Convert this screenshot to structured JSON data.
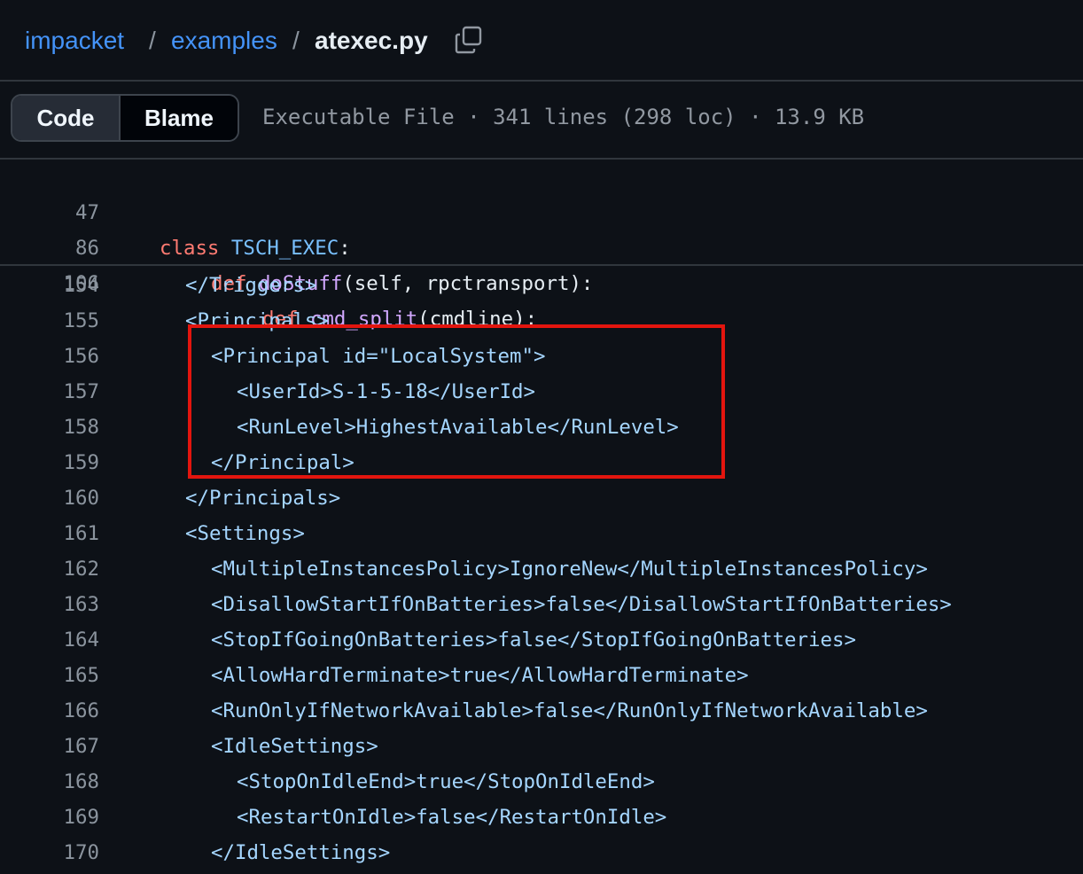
{
  "breadcrumb": {
    "repo": "impacket",
    "sep1": "/",
    "folder": "examples",
    "sep2": "/",
    "file": "atexec.py"
  },
  "toolbar": {
    "code_label": "Code",
    "blame_label": "Blame",
    "file_info": "Executable File · 341 lines (298 loc) · 13.9 KB"
  },
  "sticky_lines": [
    {
      "num": "47",
      "kw": "class",
      "name": "TSCH_EXEC",
      "rest": ":"
    },
    {
      "num": "86",
      "kw": "def",
      "name": "doStuff",
      "rest": "(self, rpctransport):"
    },
    {
      "num": "106",
      "kw": "def",
      "name": "cmd_split",
      "rest": "(cmdline):"
    }
  ],
  "code_lines": [
    {
      "num": "154",
      "text": "</Triggers>"
    },
    {
      "num": "155",
      "text": "<Principals>"
    },
    {
      "num": "156",
      "text": "<Principal id=\"LocalSystem\">"
    },
    {
      "num": "157",
      "text": "<UserId>S-1-5-18</UserId>"
    },
    {
      "num": "158",
      "text": "<RunLevel>HighestAvailable</RunLevel>"
    },
    {
      "num": "159",
      "text": "</Principal>"
    },
    {
      "num": "160",
      "text": "</Principals>"
    },
    {
      "num": "161",
      "text": "<Settings>"
    },
    {
      "num": "162",
      "text": "<MultipleInstancesPolicy>IgnoreNew</MultipleInstancesPolicy>"
    },
    {
      "num": "163",
      "text": "<DisallowStartIfOnBatteries>false</DisallowStartIfOnBatteries>"
    },
    {
      "num": "164",
      "text": "<StopIfGoingOnBatteries>false</StopIfGoingOnBatteries>"
    },
    {
      "num": "165",
      "text": "<AllowHardTerminate>true</AllowHardTerminate>"
    },
    {
      "num": "166",
      "text": "<RunOnlyIfNetworkAvailable>false</RunOnlyIfNetworkAvailable>"
    },
    {
      "num": "167",
      "text": "<IdleSettings>"
    },
    {
      "num": "168",
      "text": "<StopOnIdleEnd>true</StopOnIdleEnd>"
    },
    {
      "num": "169",
      "text": "<RestartOnIdle>false</RestartOnIdle>"
    },
    {
      "num": "170",
      "text": "</IdleSettings>"
    }
  ],
  "icons": {
    "copy": "copy-path-icon"
  },
  "colors": {
    "highlight_box": "#e3150e",
    "link": "#4493f8"
  }
}
